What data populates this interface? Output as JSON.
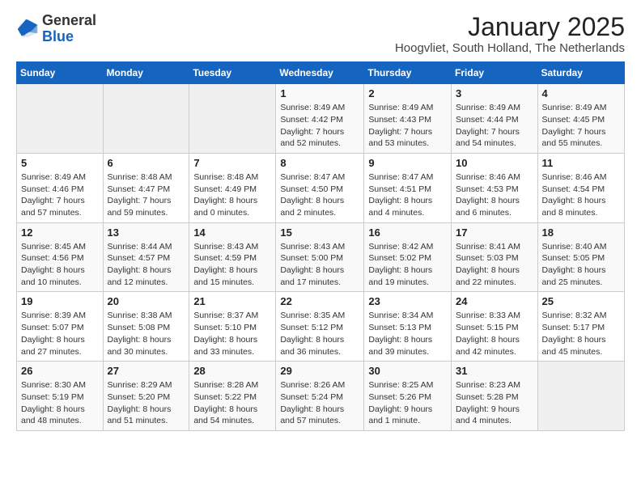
{
  "header": {
    "logo_general": "General",
    "logo_blue": "Blue",
    "title": "January 2025",
    "subtitle": "Hoogvliet, South Holland, The Netherlands"
  },
  "weekdays": [
    "Sunday",
    "Monday",
    "Tuesday",
    "Wednesday",
    "Thursday",
    "Friday",
    "Saturday"
  ],
  "weeks": [
    [
      {
        "day": "",
        "info": ""
      },
      {
        "day": "",
        "info": ""
      },
      {
        "day": "",
        "info": ""
      },
      {
        "day": "1",
        "info": "Sunrise: 8:49 AM\nSunset: 4:42 PM\nDaylight: 7 hours\nand 52 minutes."
      },
      {
        "day": "2",
        "info": "Sunrise: 8:49 AM\nSunset: 4:43 PM\nDaylight: 7 hours\nand 53 minutes."
      },
      {
        "day": "3",
        "info": "Sunrise: 8:49 AM\nSunset: 4:44 PM\nDaylight: 7 hours\nand 54 minutes."
      },
      {
        "day": "4",
        "info": "Sunrise: 8:49 AM\nSunset: 4:45 PM\nDaylight: 7 hours\nand 55 minutes."
      }
    ],
    [
      {
        "day": "5",
        "info": "Sunrise: 8:49 AM\nSunset: 4:46 PM\nDaylight: 7 hours\nand 57 minutes."
      },
      {
        "day": "6",
        "info": "Sunrise: 8:48 AM\nSunset: 4:47 PM\nDaylight: 7 hours\nand 59 minutes."
      },
      {
        "day": "7",
        "info": "Sunrise: 8:48 AM\nSunset: 4:49 PM\nDaylight: 8 hours\nand 0 minutes."
      },
      {
        "day": "8",
        "info": "Sunrise: 8:47 AM\nSunset: 4:50 PM\nDaylight: 8 hours\nand 2 minutes."
      },
      {
        "day": "9",
        "info": "Sunrise: 8:47 AM\nSunset: 4:51 PM\nDaylight: 8 hours\nand 4 minutes."
      },
      {
        "day": "10",
        "info": "Sunrise: 8:46 AM\nSunset: 4:53 PM\nDaylight: 8 hours\nand 6 minutes."
      },
      {
        "day": "11",
        "info": "Sunrise: 8:46 AM\nSunset: 4:54 PM\nDaylight: 8 hours\nand 8 minutes."
      }
    ],
    [
      {
        "day": "12",
        "info": "Sunrise: 8:45 AM\nSunset: 4:56 PM\nDaylight: 8 hours\nand 10 minutes."
      },
      {
        "day": "13",
        "info": "Sunrise: 8:44 AM\nSunset: 4:57 PM\nDaylight: 8 hours\nand 12 minutes."
      },
      {
        "day": "14",
        "info": "Sunrise: 8:43 AM\nSunset: 4:59 PM\nDaylight: 8 hours\nand 15 minutes."
      },
      {
        "day": "15",
        "info": "Sunrise: 8:43 AM\nSunset: 5:00 PM\nDaylight: 8 hours\nand 17 minutes."
      },
      {
        "day": "16",
        "info": "Sunrise: 8:42 AM\nSunset: 5:02 PM\nDaylight: 8 hours\nand 19 minutes."
      },
      {
        "day": "17",
        "info": "Sunrise: 8:41 AM\nSunset: 5:03 PM\nDaylight: 8 hours\nand 22 minutes."
      },
      {
        "day": "18",
        "info": "Sunrise: 8:40 AM\nSunset: 5:05 PM\nDaylight: 8 hours\nand 25 minutes."
      }
    ],
    [
      {
        "day": "19",
        "info": "Sunrise: 8:39 AM\nSunset: 5:07 PM\nDaylight: 8 hours\nand 27 minutes."
      },
      {
        "day": "20",
        "info": "Sunrise: 8:38 AM\nSunset: 5:08 PM\nDaylight: 8 hours\nand 30 minutes."
      },
      {
        "day": "21",
        "info": "Sunrise: 8:37 AM\nSunset: 5:10 PM\nDaylight: 8 hours\nand 33 minutes."
      },
      {
        "day": "22",
        "info": "Sunrise: 8:35 AM\nSunset: 5:12 PM\nDaylight: 8 hours\nand 36 minutes."
      },
      {
        "day": "23",
        "info": "Sunrise: 8:34 AM\nSunset: 5:13 PM\nDaylight: 8 hours\nand 39 minutes."
      },
      {
        "day": "24",
        "info": "Sunrise: 8:33 AM\nSunset: 5:15 PM\nDaylight: 8 hours\nand 42 minutes."
      },
      {
        "day": "25",
        "info": "Sunrise: 8:32 AM\nSunset: 5:17 PM\nDaylight: 8 hours\nand 45 minutes."
      }
    ],
    [
      {
        "day": "26",
        "info": "Sunrise: 8:30 AM\nSunset: 5:19 PM\nDaylight: 8 hours\nand 48 minutes."
      },
      {
        "day": "27",
        "info": "Sunrise: 8:29 AM\nSunset: 5:20 PM\nDaylight: 8 hours\nand 51 minutes."
      },
      {
        "day": "28",
        "info": "Sunrise: 8:28 AM\nSunset: 5:22 PM\nDaylight: 8 hours\nand 54 minutes."
      },
      {
        "day": "29",
        "info": "Sunrise: 8:26 AM\nSunset: 5:24 PM\nDaylight: 8 hours\nand 57 minutes."
      },
      {
        "day": "30",
        "info": "Sunrise: 8:25 AM\nSunset: 5:26 PM\nDaylight: 9 hours\nand 1 minute."
      },
      {
        "day": "31",
        "info": "Sunrise: 8:23 AM\nSunset: 5:28 PM\nDaylight: 9 hours\nand 4 minutes."
      },
      {
        "day": "",
        "info": ""
      }
    ]
  ]
}
